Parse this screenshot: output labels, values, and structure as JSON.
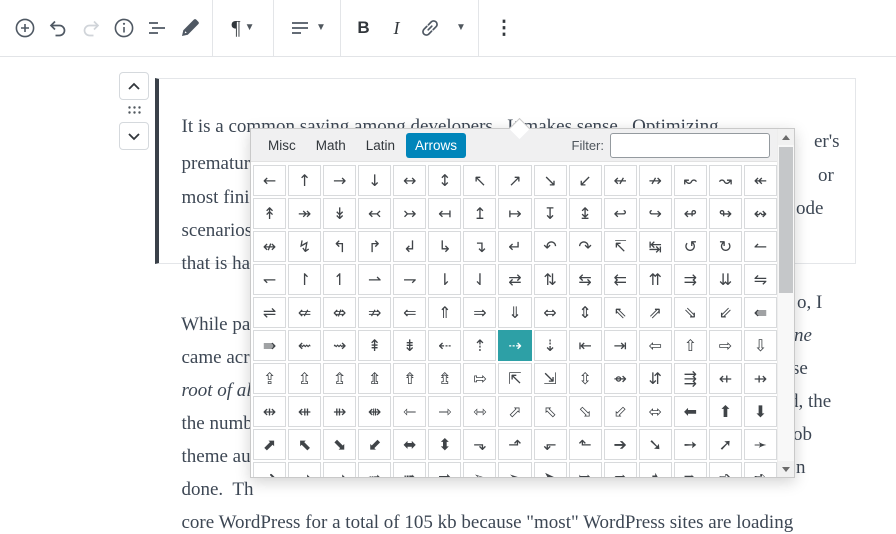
{
  "toolbar": {
    "paragraph_label": "¶",
    "bold_label": "B",
    "italic_label": "I",
    "kebab_label": "⋮"
  },
  "charmap": {
    "tabs": [
      "Misc",
      "Math",
      "Latin",
      "Arrows"
    ],
    "active_tab": "Arrows",
    "filter_label": "Filter:",
    "filter_value": "",
    "active_tab_color": "#0085ba",
    "selected_cell_color": "#2da0a6",
    "selected": {
      "row": 5,
      "col": 7,
      "char": "⇢"
    },
    "rows": [
      [
        "←",
        "↑",
        "→",
        "↓",
        "↔",
        "↕",
        "↖",
        "↗",
        "↘",
        "↙",
        "↚",
        "↛",
        "↜",
        "↝",
        "↞"
      ],
      [
        "↟",
        "↠",
        "↡",
        "↢",
        "↣",
        "↤",
        "↥",
        "↦",
        "↧",
        "↨",
        "↩",
        "↪",
        "↫",
        "↬",
        "↭"
      ],
      [
        "↮",
        "↯",
        "↰",
        "↱",
        "↲",
        "↳",
        "↴",
        "↵",
        "↶",
        "↷",
        "↸",
        "↹",
        "↺",
        "↻",
        "↼"
      ],
      [
        "↽",
        "↾",
        "↿",
        "⇀",
        "⇁",
        "⇂",
        "⇃",
        "⇄",
        "⇅",
        "⇆",
        "⇇",
        "⇈",
        "⇉",
        "⇊",
        "⇋"
      ],
      [
        "⇌",
        "⇍",
        "⇎",
        "⇏",
        "⇐",
        "⇑",
        "⇒",
        "⇓",
        "⇔",
        "⇕",
        "⇖",
        "⇗",
        "⇘",
        "⇙",
        "⇚"
      ],
      [
        "⇛",
        "⇜",
        "⇝",
        "⇞",
        "⇟",
        "⇠",
        "⇡",
        "⇢",
        "⇣",
        "⇤",
        "⇥",
        "⇦",
        "⇧",
        "⇨",
        "⇩"
      ],
      [
        "⇪",
        "⇫",
        "⇬",
        "⇭",
        "⇮",
        "⇯",
        "⇰",
        "⇱",
        "⇲",
        "⇳",
        "⇴",
        "⇵",
        "⇶",
        "⇷",
        "⇸"
      ],
      [
        "⇹",
        "⇺",
        "⇻",
        "⇼",
        "⇽",
        "⇾",
        "⇿",
        "⬀",
        "⬁",
        "⬂",
        "⬃",
        "⬄",
        "⬅",
        "⬆",
        "⬇"
      ],
      [
        "⬈",
        "⬉",
        "⬊",
        "⬋",
        "⬌",
        "⬍",
        "⬎",
        "⬏",
        "⬐",
        "⬑",
        "➔",
        "➘",
        "➙",
        "➚",
        "➛"
      ],
      [
        "➜",
        "➝",
        "➞",
        "➟",
        "➠",
        "➡",
        "➢",
        "➣",
        "➤",
        "➥",
        "➦",
        "➧",
        "➨",
        "➩",
        "➪"
      ]
    ]
  },
  "doc": {
    "block1": {
      "line1_full": "It is a common saying among developers.  It makes sense.  Optimizing",
      "line2_left": "prematur",
      "line2_right": "er's",
      "line3_left": "most fini",
      "line3_right": "or",
      "line4_left": "scenarios",
      "line4_right": "ode",
      "line5_left": "that is ha"
    },
    "block2": {
      "line1_left": "While pa",
      "line1_right": "o, I",
      "line2_left": "came acr",
      "line2_right": "ne",
      "line3_left": "root of ali",
      "line3_right": "se",
      "line4_left": "the numb",
      "line4_right": "d, the",
      "line5_left": "theme au",
      "line5_right": "ob",
      "line6_left": "done.  Th",
      "line6_right": "n",
      "line7_full": "core WordPress for a total of 105 kb because \"most\" WordPress sites are loading"
    }
  }
}
